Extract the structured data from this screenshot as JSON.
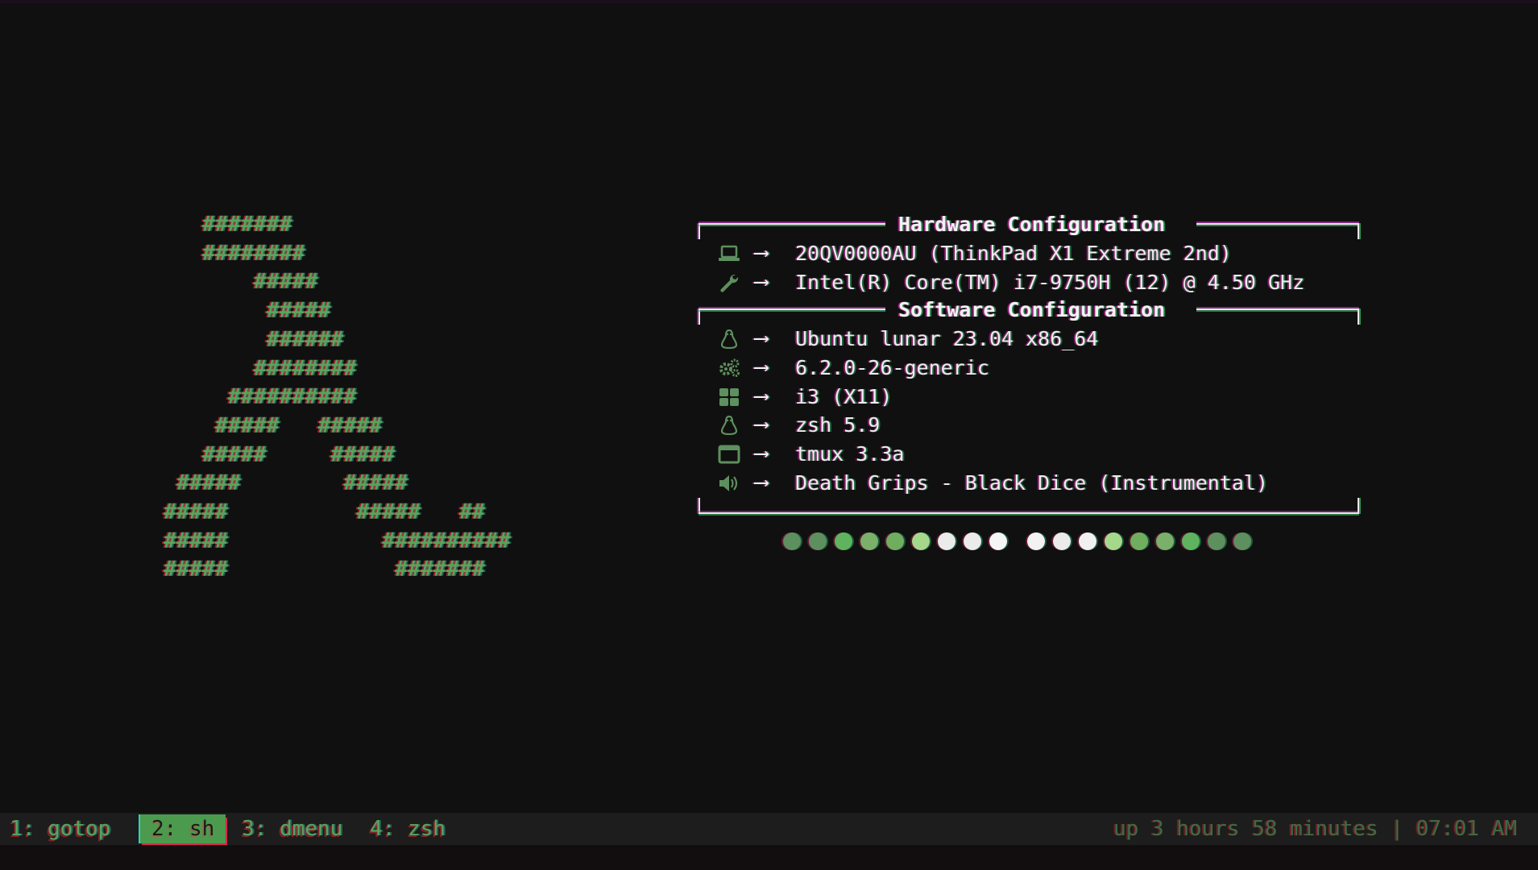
{
  "logo_lines": [
    "   #######",
    "   ########",
    "       #####",
    "        #####",
    "        ######",
    "       ########",
    "     ##########",
    "    #####   #####",
    "   #####     #####",
    " #####        #####",
    "#####          #####   ##",
    "#####            ##########",
    "#####             #######"
  ],
  "hardware": {
    "title": "Hardware Configuration",
    "rows": [
      {
        "icon": "laptop-icon",
        "value": "20QV0000AU (ThinkPad X1 Extreme 2nd)"
      },
      {
        "icon": "wrench-icon",
        "value": "Intel(R) Core(TM) i7-9750H (12) @ 4.50 GHz"
      }
    ]
  },
  "software": {
    "title": "Software Configuration",
    "rows": [
      {
        "icon": "linux-tux-icon",
        "value": "Ubuntu lunar 23.04 x86_64"
      },
      {
        "icon": "gears-icon",
        "value": "6.2.0-26-generic"
      },
      {
        "icon": "windows-grid-icon",
        "value": "i3 (X11)"
      },
      {
        "icon": "linux-tux-icon",
        "value": "zsh 5.9"
      },
      {
        "icon": "terminal-window-icon",
        "value": "tmux 3.3a"
      },
      {
        "icon": "speaker-icon",
        "value": "Death Grips - Black Dice (Instrumental)"
      }
    ]
  },
  "arrow_glyph": "⟶",
  "palette": {
    "left": [
      "#5e8f5e",
      "#5e8f5e",
      "#5fb35f",
      "#7ab06a",
      "#6fae5f",
      "#a6d88c",
      "#ebebeb",
      "#ebebeb",
      "#f5f5f5"
    ],
    "right": [
      "#f2f2f2",
      "#ebebeb",
      "#f0f0f0",
      "#a6d88c",
      "#6fae5f",
      "#7ab06a",
      "#5fb35f",
      "#5e8f5e",
      "#5e8f5e"
    ]
  },
  "statusbar": {
    "workspaces": [
      {
        "label": "1: gotop",
        "active": false
      },
      {
        "label": "2: sh",
        "active": true
      },
      {
        "label": "3: dmenu",
        "active": false
      },
      {
        "label": "4: zsh",
        "active": false
      }
    ],
    "uptime": "up 3 hours 58 minutes",
    "separator": "|",
    "clock": "07:01 AM"
  },
  "colors": {
    "background": "#101010",
    "accent_green": "#5aa35c",
    "text": "#ededed",
    "active_ws_bg": "#4b9a4d"
  }
}
